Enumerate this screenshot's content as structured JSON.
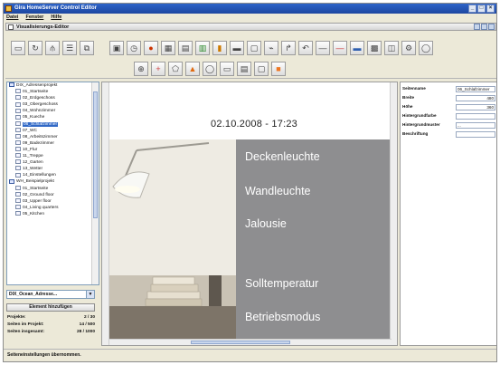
{
  "window": {
    "title": "Gira HomeServer Control Editor"
  },
  "menu": {
    "items": [
      "Datei",
      "Fenster",
      "Hilfe"
    ]
  },
  "subwindow": {
    "title": "Visualisierungs-Editor"
  },
  "toolbar": {
    "row1_icons": [
      "new-page-icon",
      "refresh-icon",
      "split-icon",
      "list-icon",
      "copy-icon",
      "gap",
      "image-icon",
      "clock-icon",
      "circle-icon",
      "grid-icon",
      "table-icon",
      "chart-icon",
      "bar-icon",
      "slider-icon",
      "window-icon",
      "link-icon",
      "arrow-icon",
      "undo-icon",
      "line-icon",
      "line-red-icon",
      "bluebar-icon",
      "video-icon",
      "frame-icon",
      "plugin-icon",
      "info-icon"
    ],
    "row2_icons": [
      "select-icon",
      "plus-icon",
      "polygon-icon",
      "triangle-icon",
      "ellipse-icon",
      "rect-icon",
      "panel-icon",
      "window-icon",
      "orange-square-icon"
    ]
  },
  "tree": {
    "items": [
      {
        "label": "DIX_Adressenprojekt",
        "root": true
      },
      {
        "label": "01_Startseite"
      },
      {
        "label": "02_Erdgeschoss"
      },
      {
        "label": "03_Obergeschoss"
      },
      {
        "label": "04_Wohnzimmer"
      },
      {
        "label": "05_Kueche"
      },
      {
        "label": "06_Schlafzimmer",
        "selected": true
      },
      {
        "label": "07_WC"
      },
      {
        "label": "08_Arbeitszimmer"
      },
      {
        "label": "09_Badezimmer"
      },
      {
        "label": "10_Flur"
      },
      {
        "label": "11_Treppe"
      },
      {
        "label": "12_Garten"
      },
      {
        "label": "13_Wetter"
      },
      {
        "label": "14_Einstellungen"
      },
      {
        "label": "WH_Beispielprojekt",
        "root": true
      },
      {
        "label": "01_Startseite"
      },
      {
        "label": "02_Ground floor"
      },
      {
        "label": "03_Upper floor"
      },
      {
        "label": "04_Living quarters"
      },
      {
        "label": "05_Kitchen"
      }
    ]
  },
  "left_panel": {
    "combo_value": "DIX_Ocean_Adresse...",
    "button_label": "Element hinzufügen",
    "stats": [
      {
        "label": "Projekte:",
        "value": "2 / 30"
      },
      {
        "label": "Seiten im Projekt:",
        "value": "14 / 500"
      },
      {
        "label": "Seiten insgesamt:",
        "value": "28 / 1000"
      }
    ]
  },
  "canvas": {
    "datetime": "02.10.2008 - 17:23",
    "labels": [
      "Deckenleuchte",
      "Wandleuchte",
      "Jalousie",
      "Solltemperatur",
      "Betriebsmodus"
    ]
  },
  "properties": {
    "rows": [
      {
        "key": "Seitenname",
        "value": "06_Schlafzimmer",
        "num": false
      },
      {
        "key": "Breite",
        "value": "480",
        "num": true
      },
      {
        "key": "Höhe",
        "value": "360",
        "num": true
      },
      {
        "key": "Hintergrundfarbe",
        "value": "",
        "num": false
      },
      {
        "key": "Hintergrundmuster",
        "value": "...",
        "num": false
      },
      {
        "key": "Beschriftung",
        "value": "",
        "num": false
      }
    ]
  },
  "statusbar": {
    "text": "Seiteneinstellungen übernommen."
  },
  "colors": {
    "accent": "#3169c6",
    "panel_gray": "#8e8e90",
    "titlebar": "#2d63c8"
  }
}
